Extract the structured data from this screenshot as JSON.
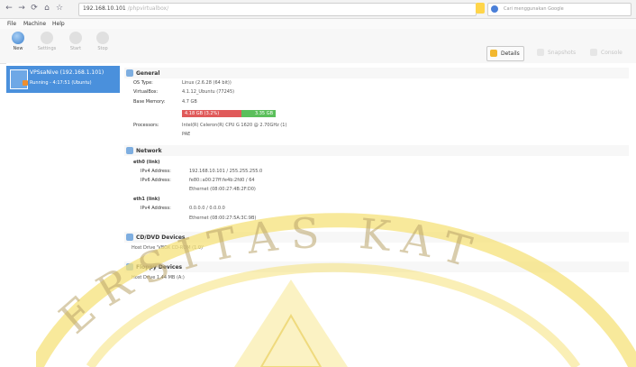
{
  "browser": {
    "url_host": "192.168.10.101",
    "url_path": "/phpvirtualbox/",
    "search_placeholder": "Cari menggunakan Google"
  },
  "menu": [
    "File",
    "Machine",
    "Help"
  ],
  "toolbar": {
    "tools": [
      "New",
      "Settings",
      "Start",
      "Stop"
    ],
    "details_label": "Details",
    "snapshots_label": "Snapshots",
    "console_label": "Console"
  },
  "vm": {
    "name": "VPSsaNive (192.168.1.101)",
    "state": "Running - 4:17:51 (Ubuntu)"
  },
  "general": {
    "title": "General",
    "rows": [
      {
        "label": "OS Type:",
        "value": "Linux (2.6.28 (64 bit))"
      },
      {
        "label": "VirtualBox:",
        "value": "4.1.12_Ubuntu (77245)"
      },
      {
        "label": "Base Memory:",
        "value": "4.7 GB"
      },
      {
        "label": "Processors:",
        "value": "Intel(R) Celeron(R) CPU G 1620 @ 2.70GHz (1)"
      },
      {
        "label": "",
        "value": "PAE"
      }
    ],
    "memory": {
      "used_label": "4.18 GB (3.2%)",
      "free_label": "3.35 GB",
      "used_fraction": 0.63
    }
  },
  "network": {
    "title": "Network",
    "groups": [
      {
        "name": "eth0 (link)",
        "rows": [
          {
            "label": "IPv4 Address:",
            "value": "192.168.10.101 / 255.255.255.0"
          },
          {
            "label": "IPv6 Address:",
            "value": "fe80::a00:27ff:fe4b:2fd0 / 64"
          },
          {
            "label": "",
            "value": "Ethernet (08:00:27:4B:2F:D0)"
          }
        ]
      },
      {
        "name": "eth1 (link)",
        "rows": [
          {
            "label": "IPv4 Address:",
            "value": "0.0.0.0 / 0.0.0.0"
          },
          {
            "label": "",
            "value": "Ethernet (08:00:27:5A:3C:9B)"
          }
        ]
      }
    ]
  },
  "cd_dvd": {
    "title": "CD/DVD Devices",
    "value": "Host Drive 'VBOX CD-ROM (1.0)'"
  },
  "floppy": {
    "title": "Floppy Devices",
    "value": "Host Drive 1.44 MB (A:)"
  },
  "watermark": {
    "text": "ERSITAS KAT",
    "color": "#f6e27a"
  }
}
